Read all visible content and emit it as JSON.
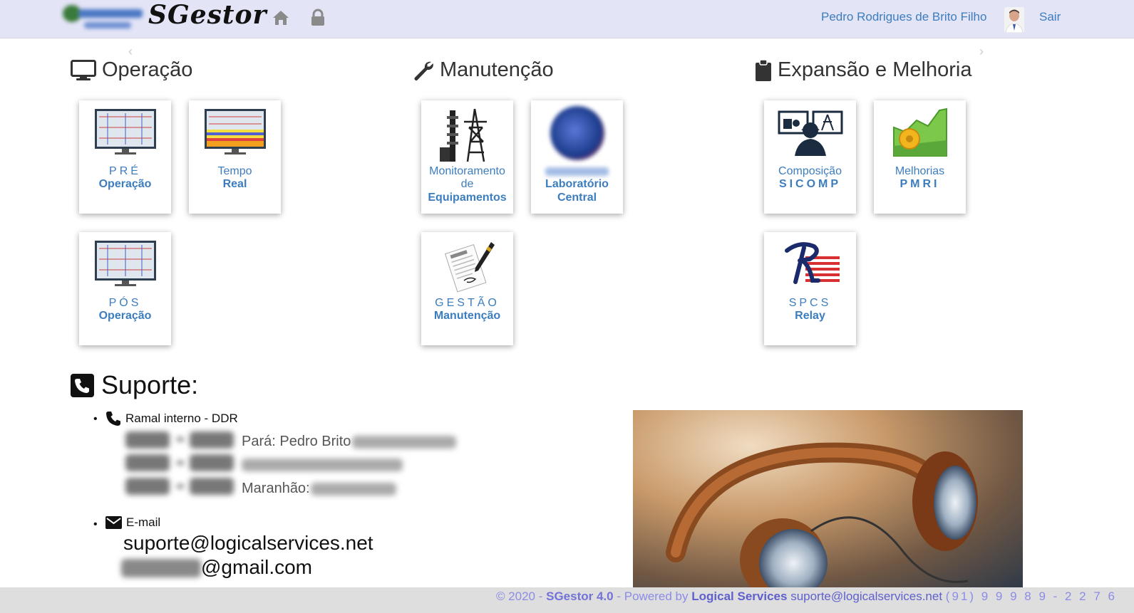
{
  "header": {
    "brand": "SGestor",
    "user_name": "Pedro Rodrigues de Brito Filho",
    "logout_label": "Sair"
  },
  "sections": {
    "operacao": {
      "title": "Operação",
      "cards": [
        {
          "line1": "PRÉ",
          "line2": "Operação"
        },
        {
          "line1": "Tempo",
          "line2": "Real"
        },
        {
          "line1": "PÓS",
          "line2": "Operação"
        }
      ]
    },
    "manutencao": {
      "title": "Manutenção",
      "cards": [
        {
          "line1": "Monitoramento",
          "line2": "de",
          "line3": "Equipamentos"
        },
        {
          "line2": "Laboratório",
          "line3": "Central"
        },
        {
          "line1": "GESTÃO",
          "line2": "Manutenção"
        }
      ]
    },
    "expansao": {
      "title": "Expansão e Melhoria",
      "cards": [
        {
          "line1": "Composição",
          "line2": "SICOMP"
        },
        {
          "line1": "Melhorias",
          "line2": "PMRI"
        },
        {
          "line1": "SPCS",
          "line2": "Relay"
        }
      ]
    }
  },
  "suporte": {
    "title": "Suporte:",
    "ramal_label": "Ramal interno - DDR",
    "contacts": [
      {
        "prefix": "Pará: Pedro Brito"
      },
      {
        "prefix": ""
      },
      {
        "prefix": "Maranhão:"
      }
    ],
    "email_label": "E-mail",
    "emails": [
      "suporte@logicalservices.net",
      "@gmail.com"
    ]
  },
  "footer": {
    "copyright": "© 2020 -",
    "product": "SGestor 4.0",
    "powered": "- Powered by",
    "company": "Logical Services",
    "email": "suporte@logicalservices.net",
    "phone": "(91) 9 9 9 8 9 - 2 2 7 6"
  },
  "colors": {
    "link": "#3c7dbf",
    "header_bg": "#e4e4f7",
    "footer_text": "#8c8ce6"
  }
}
